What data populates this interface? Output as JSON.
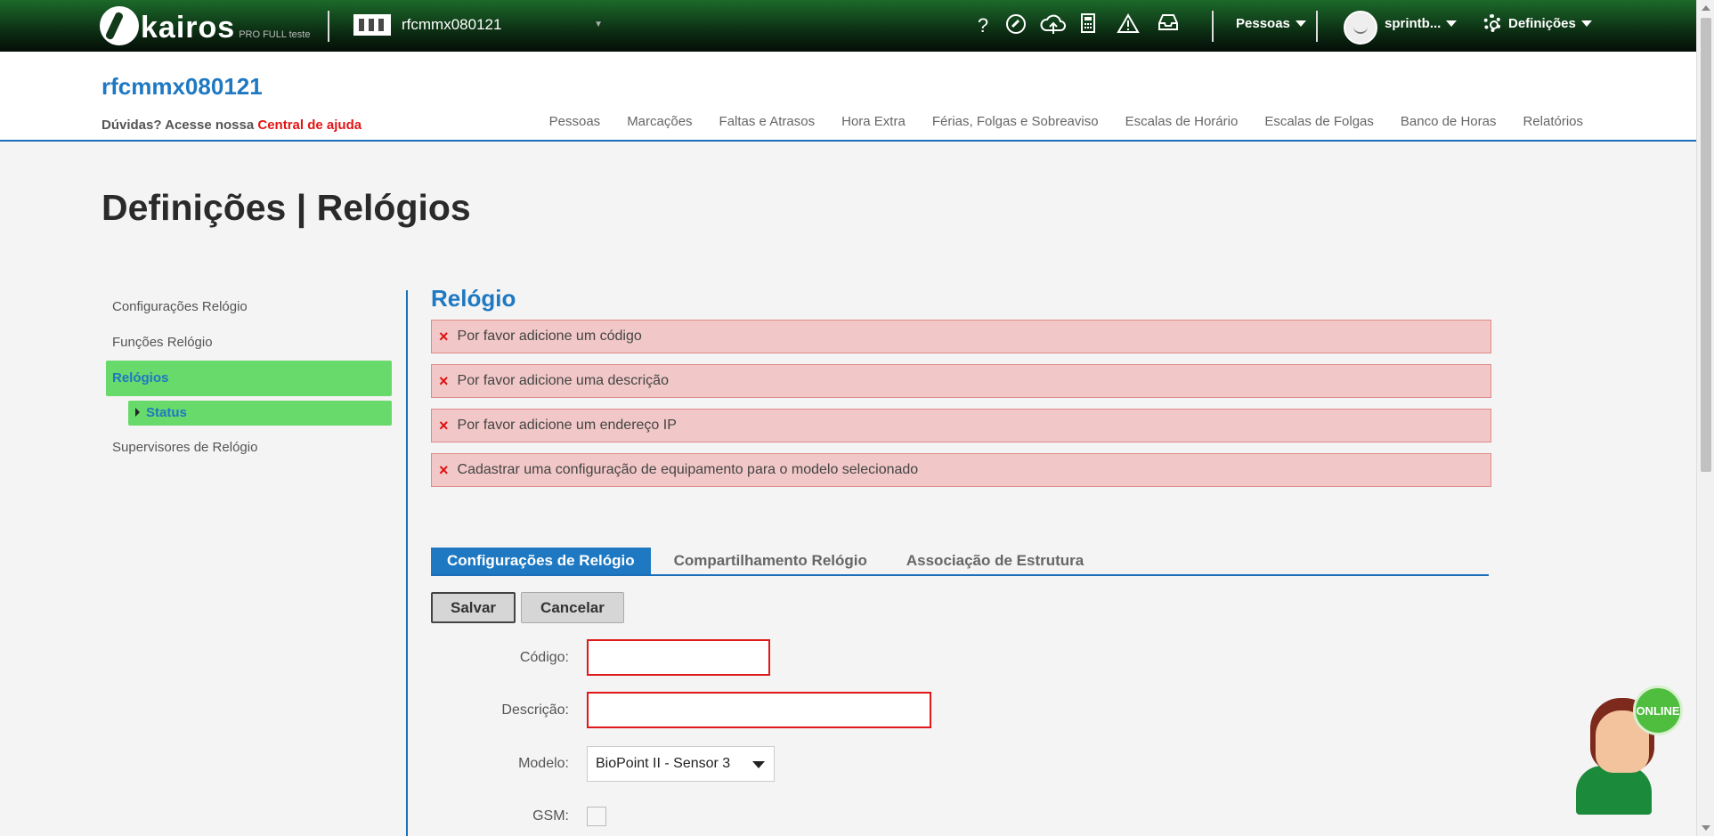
{
  "topbar": {
    "logo_text": "kairos",
    "logo_sub": "PRO FULL teste",
    "company": "rfcmmx080121",
    "icons": [
      "question-icon",
      "chat-bubble-icon",
      "cloud-upload-icon",
      "calculator-icon",
      "warning-icon",
      "inbox-icon"
    ],
    "help_glyph": "?",
    "people_menu": "Pessoas",
    "user": "sprintb...",
    "settings": "Definições"
  },
  "header": {
    "company_title": "rfcmmx080121",
    "help_prefix": "Dúvidas? Acesse nossa",
    "help_link": "Central de ajuda",
    "nav": [
      "Pessoas",
      "Marcações",
      "Faltas e Atrasos",
      "Hora Extra",
      "Férias, Folgas e Sobreaviso",
      "Escalas de Horário",
      "Escalas de Folgas",
      "Banco de Horas",
      "Relatórios"
    ]
  },
  "page_title": "Definições | Relógios",
  "sidebar": {
    "items": [
      "Configurações Relógio",
      "Funções Relógio",
      "Relógios",
      "Supervisores de Relógio"
    ],
    "active": "Relógios",
    "sub_item": "Status"
  },
  "content": {
    "section_title": "Relógio",
    "alerts": [
      "Por favor adicione um código",
      "Por favor adicione uma descrição",
      "Por favor adicione um endereço IP",
      "Cadastrar uma configuração de equipamento para o modelo selecionado"
    ],
    "alert_glyph": "×",
    "tabs": [
      "Configurações de Relógio",
      "Compartilhamento Relógio",
      "Associação de Estrutura"
    ],
    "active_tab": "Configurações de Relógio",
    "buttons": {
      "save": "Salvar",
      "cancel": "Cancelar"
    },
    "form": {
      "code_label": "Código:",
      "code_value": "",
      "description_label": "Descrição:",
      "description_value": "",
      "model_label": "Modelo:",
      "model_value": "BioPoint II - Sensor 3",
      "gsm_label": "GSM:",
      "gsm_checked": false
    }
  },
  "chat_widget": {
    "status": "ONLINE"
  },
  "colors": {
    "accent": "#1e78c2",
    "active_green": "#68d96b",
    "error": "#e01818",
    "topbar": "#0a2510"
  }
}
